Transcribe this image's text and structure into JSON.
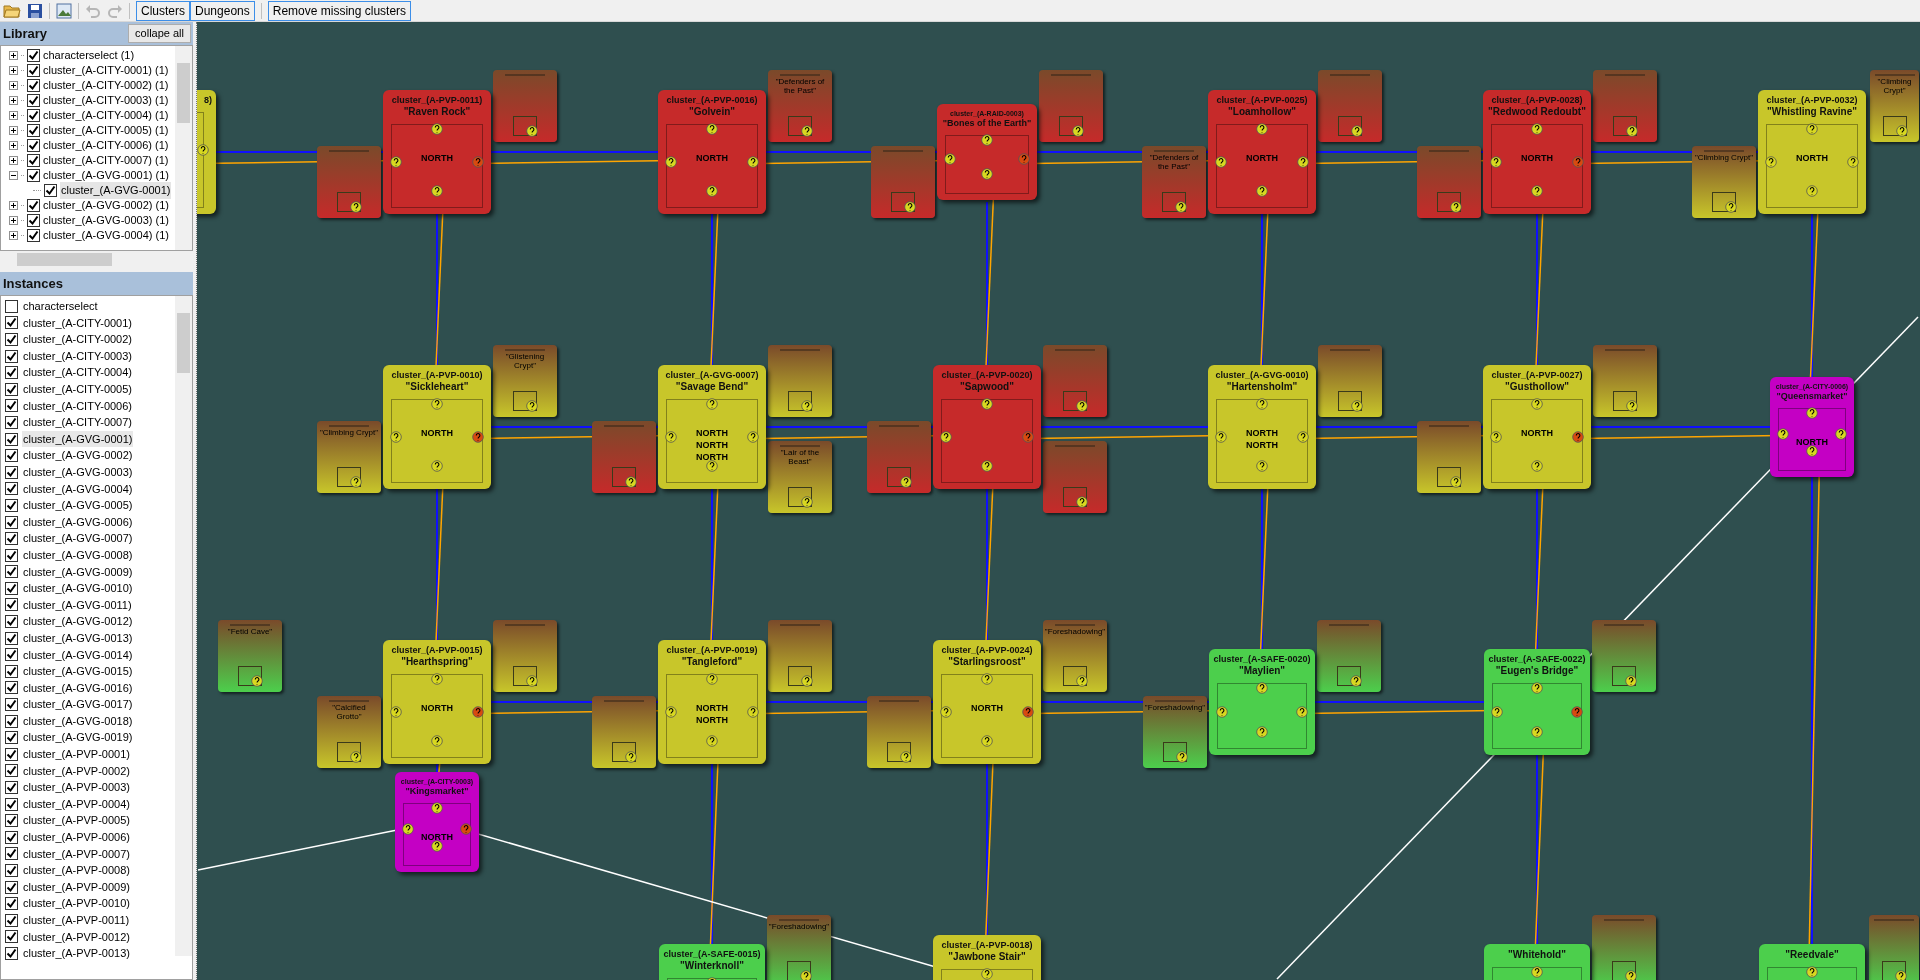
{
  "toolbar": {
    "tools": [
      {
        "kind": "open",
        "disabled": false
      },
      {
        "kind": "save",
        "disabled": false
      },
      {
        "kind": "image",
        "disabled": false
      },
      {
        "kind": "undo",
        "disabled": true
      },
      {
        "kind": "redo",
        "disabled": true
      }
    ],
    "buttons": [
      {
        "label": "Clusters"
      },
      {
        "label": "Dungeons"
      },
      {
        "label": "Remove missing clusters"
      }
    ]
  },
  "library": {
    "title": "Library",
    "collapse_button": "collape all",
    "items": [
      {
        "label": "characterselect (1)",
        "checked": true,
        "expanded": false
      },
      {
        "label": "cluster_(A-CITY-0001) (1)",
        "checked": true,
        "expanded": false
      },
      {
        "label": "cluster_(A-CITY-0002) (1)",
        "checked": true,
        "expanded": false
      },
      {
        "label": "cluster_(A-CITY-0003) (1)",
        "checked": true,
        "expanded": false
      },
      {
        "label": "cluster_(A-CITY-0004) (1)",
        "checked": true,
        "expanded": false
      },
      {
        "label": "cluster_(A-CITY-0005) (1)",
        "checked": true,
        "expanded": false
      },
      {
        "label": "cluster_(A-CITY-0006) (1)",
        "checked": true,
        "expanded": false
      },
      {
        "label": "cluster_(A-CITY-0007) (1)",
        "checked": true,
        "expanded": false
      },
      {
        "label": "cluster_(A-GVG-0001) (1)",
        "checked": true,
        "expanded": true,
        "children": [
          {
            "label": "cluster_(A-GVG-0001)",
            "checked": true,
            "selected": true
          }
        ]
      },
      {
        "label": "cluster_(A-GVG-0002) (1)",
        "checked": true,
        "expanded": false
      },
      {
        "label": "cluster_(A-GVG-0003) (1)",
        "checked": true,
        "expanded": false
      },
      {
        "label": "cluster_(A-GVG-0004) (1)",
        "checked": true,
        "expanded": false
      }
    ]
  },
  "instances": {
    "title": "Instances",
    "items": [
      {
        "label": "characterselect",
        "checked": false,
        "selected": false
      },
      {
        "label": "cluster_(A-CITY-0001)",
        "checked": true,
        "selected": false
      },
      {
        "label": "cluster_(A-CITY-0002)",
        "checked": true,
        "selected": false
      },
      {
        "label": "cluster_(A-CITY-0003)",
        "checked": true,
        "selected": false
      },
      {
        "label": "cluster_(A-CITY-0004)",
        "checked": true,
        "selected": false
      },
      {
        "label": "cluster_(A-CITY-0005)",
        "checked": true,
        "selected": false
      },
      {
        "label": "cluster_(A-CITY-0006)",
        "checked": true,
        "selected": false
      },
      {
        "label": "cluster_(A-CITY-0007)",
        "checked": true,
        "selected": false
      },
      {
        "label": "cluster_(A-GVG-0001)",
        "checked": true,
        "selected": true
      },
      {
        "label": "cluster_(A-GVG-0002)",
        "checked": true,
        "selected": false
      },
      {
        "label": "cluster_(A-GVG-0003)",
        "checked": true,
        "selected": false
      },
      {
        "label": "cluster_(A-GVG-0004)",
        "checked": true,
        "selected": false
      },
      {
        "label": "cluster_(A-GVG-0005)",
        "checked": true,
        "selected": false
      },
      {
        "label": "cluster_(A-GVG-0006)",
        "checked": true,
        "selected": false
      },
      {
        "label": "cluster_(A-GVG-0007)",
        "checked": true,
        "selected": false
      },
      {
        "label": "cluster_(A-GVG-0008)",
        "checked": true,
        "selected": false
      },
      {
        "label": "cluster_(A-GVG-0009)",
        "checked": true,
        "selected": false
      },
      {
        "label": "cluster_(A-GVG-0010)",
        "checked": true,
        "selected": false
      },
      {
        "label": "cluster_(A-GVG-0011)",
        "checked": true,
        "selected": false
      },
      {
        "label": "cluster_(A-GVG-0012)",
        "checked": true,
        "selected": false
      },
      {
        "label": "cluster_(A-GVG-0013)",
        "checked": true,
        "selected": false
      },
      {
        "label": "cluster_(A-GVG-0014)",
        "checked": true,
        "selected": false
      },
      {
        "label": "cluster_(A-GVG-0015)",
        "checked": true,
        "selected": false
      },
      {
        "label": "cluster_(A-GVG-0016)",
        "checked": true,
        "selected": false
      },
      {
        "label": "cluster_(A-GVG-0017)",
        "checked": true,
        "selected": false
      },
      {
        "label": "cluster_(A-GVG-0018)",
        "checked": true,
        "selected": false
      },
      {
        "label": "cluster_(A-GVG-0019)",
        "checked": true,
        "selected": false
      },
      {
        "label": "cluster_(A-PVP-0001)",
        "checked": true,
        "selected": false
      },
      {
        "label": "cluster_(A-PVP-0002)",
        "checked": true,
        "selected": false
      },
      {
        "label": "cluster_(A-PVP-0003)",
        "checked": true,
        "selected": false
      },
      {
        "label": "cluster_(A-PVP-0004)",
        "checked": true,
        "selected": false
      },
      {
        "label": "cluster_(A-PVP-0005)",
        "checked": true,
        "selected": false
      },
      {
        "label": "cluster_(A-PVP-0006)",
        "checked": true,
        "selected": false
      },
      {
        "label": "cluster_(A-PVP-0007)",
        "checked": true,
        "selected": false
      },
      {
        "label": "cluster_(A-PVP-0008)",
        "checked": true,
        "selected": false
      },
      {
        "label": "cluster_(A-PVP-0009)",
        "checked": true,
        "selected": false
      },
      {
        "label": "cluster_(A-PVP-0010)",
        "checked": true,
        "selected": false
      },
      {
        "label": "cluster_(A-PVP-0011)",
        "checked": true,
        "selected": false
      },
      {
        "label": "cluster_(A-PVP-0012)",
        "checked": true,
        "selected": false
      },
      {
        "label": "cluster_(A-PVP-0013)",
        "checked": true,
        "selected": false
      }
    ]
  },
  "map": {
    "rows": [
      [
        {
          "kind": "edge",
          "id": "8)",
          "color": "#c8c62a"
        },
        {
          "kind": "zone",
          "id": "cluster_(A-PVP-0011)",
          "name": "\"Raven Rock\"",
          "color": "#c62a2a",
          "labels": [
            "NORTH"
          ],
          "dungeons": [
            {
              "kind": "red"
            },
            {
              "kind": "red"
            }
          ]
        },
        {
          "kind": "zone",
          "id": "cluster_(A-PVP-0016)",
          "name": "\"Golvein\"",
          "color": "#c62a2a",
          "labels": [
            "NORTH"
          ],
          "dungeons": [
            {
              "kind": "red",
              "title": "\"Defenders of the Past\""
            }
          ]
        },
        {
          "kind": "raid",
          "id": "cluster_(A-RAID-0003)",
          "name": "\"Bones of the Earth\"",
          "color": "#c62a2a",
          "dungeons": [
            {
              "kind": "red"
            },
            {
              "kind": "red"
            }
          ]
        },
        {
          "kind": "zone",
          "id": "cluster_(A-PVP-0025)",
          "name": "\"Loamhollow\"",
          "color": "#c62a2a",
          "labels": [
            "NORTH"
          ],
          "dungeons": [
            {
              "kind": "red"
            },
            {
              "kind": "red",
              "title": "\"Defenders of the Past\""
            }
          ]
        },
        {
          "kind": "zone",
          "id": "cluster_(A-PVP-0028)",
          "name": "\"Redwood Redoubt\"",
          "color": "#c62a2a",
          "labels": [
            "NORTH"
          ],
          "dungeons": [
            {
              "kind": "red"
            },
            {
              "kind": "red"
            }
          ]
        },
        {
          "kind": "zone",
          "id": "cluster_(A-PVP-0032)",
          "name": "\"Whistling Ravine\"",
          "color": "#c8c62a",
          "labels": [
            "NORTH"
          ],
          "dungeons": [
            {
              "kind": "yellow",
              "title": "\"Climbing Crypt\""
            },
            {
              "kind": "yellow",
              "title": "\"Climbing Crypt\""
            }
          ]
        }
      ],
      [
        null,
        {
          "kind": "zone",
          "id": "cluster_(A-PVP-0010)",
          "name": "\"Sickleheart\"",
          "color": "#c8c62a",
          "labels": [
            "NORTH"
          ],
          "dungeons": [
            {
              "kind": "yellow",
              "title": "\"Glistening Crypt\""
            },
            {
              "kind": "yellow",
              "title": "\"Climbing Crypt\""
            }
          ]
        },
        {
          "kind": "zone",
          "id": "cluster_(A-GVG-0007)",
          "name": "\"Savage Bend\"",
          "color": "#c8c62a",
          "labels": [
            "NORTH",
            "NORTH",
            "NORTH"
          ],
          "dungeons": [
            {
              "kind": "yellow"
            },
            {
              "kind": "red"
            },
            {
              "kind": "yellow",
              "title": "\"Lair of the Beast\""
            }
          ]
        },
        {
          "kind": "zone",
          "id": "cluster_(A-PVP-0020)",
          "name": "\"Sapwood\"",
          "color": "#c62a2a",
          "dungeons": [
            {
              "kind": "red"
            },
            {
              "kind": "red"
            },
            {
              "kind": "red"
            }
          ]
        },
        {
          "kind": "zone",
          "id": "cluster_(A-GVG-0010)",
          "name": "\"Hartensholm\"",
          "color": "#c8c62a",
          "labels": [
            "NORTH",
            "NORTH"
          ],
          "dungeons": [
            {
              "kind": "yellow"
            }
          ]
        },
        {
          "kind": "zone",
          "id": "cluster_(A-PVP-0027)",
          "name": "\"Gusthollow\"",
          "color": "#c8c62a",
          "labels": [
            "NORTH"
          ],
          "dungeons": [
            {
              "kind": "yellow"
            },
            {
              "kind": "yellow"
            }
          ]
        },
        {
          "kind": "city",
          "id": "cluster_(A-CITY-0006)",
          "name": "\"Queensmarket\"",
          "color": "#c400c4",
          "labels": [
            "NORTH"
          ]
        }
      ],
      [
        {
          "kind": "none",
          "dungeons": [
            {
              "kind": "green",
              "title": "\"Fetid Cave\""
            }
          ]
        },
        {
          "kind": "zone",
          "id": "cluster_(A-PVP-0015)",
          "name": "\"Hearthspring\"",
          "color": "#c8c62a",
          "labels": [
            "NORTH"
          ],
          "dungeons": [
            {
              "kind": "yellow"
            },
            {
              "kind": "yellow",
              "title": "\"Calcified Grotto\""
            }
          ]
        },
        {
          "kind": "zone",
          "id": "cluster_(A-PVP-0019)",
          "name": "\"Tangleford\"",
          "color": "#c8c62a",
          "labels": [
            "NORTH",
            "NORTH"
          ],
          "dungeons": [
            {
              "kind": "yellow"
            },
            {
              "kind": "yellow"
            }
          ]
        },
        {
          "kind": "zone",
          "id": "cluster_(A-PVP-0024)",
          "name": "\"Starlingsroost\"",
          "color": "#c8c62a",
          "labels": [
            "NORTH"
          ],
          "dungeons": [
            {
              "kind": "yellow",
              "title": "\"Foreshadowing\""
            },
            {
              "kind": "yellow"
            }
          ]
        },
        {
          "kind": "safe",
          "id": "cluster_(A-SAFE-0020)",
          "name": "\"Maylien\"",
          "color": "#4ccf4c",
          "dungeons": [
            {
              "kind": "green"
            },
            {
              "kind": "green",
              "title": "\"Foreshadowing\""
            }
          ]
        },
        {
          "kind": "safe",
          "id": "cluster_(A-SAFE-0022)",
          "name": "\"Eugen's Bridge\"",
          "color": "#4ccf4c",
          "dungeons": [
            {
              "kind": "green"
            }
          ]
        },
        null
      ],
      [
        null,
        {
          "kind": "city",
          "id": "cluster_(A-CITY-0003)",
          "name": "\"Kingsmarket\"",
          "color": "#c400c4",
          "labels": [
            "NORTH"
          ]
        },
        null,
        null,
        null,
        null,
        null
      ],
      [
        null,
        null,
        {
          "kind": "safe",
          "id": "cluster_(A-SAFE-0015)",
          "name": "\"Winterknoll\"",
          "color": "#4ccf4c",
          "dungeons": [
            {
              "kind": "green",
              "title": "\"Foreshadowing\""
            }
          ]
        },
        {
          "kind": "zone",
          "id": "cluster_(A-PVP-0018)",
          "name": "\"Jawbone Stair\"",
          "color": "#c8c62a"
        },
        null,
        {
          "kind": "safe",
          "name": "\"Whitehold\"",
          "color": "#4ccf4c",
          "dungeons": [
            {
              "kind": "green"
            }
          ]
        },
        {
          "kind": "safe",
          "name": "\"Reedvale\"",
          "color": "#4ccf4c",
          "dungeons": [
            {
              "kind": "green"
            }
          ]
        }
      ]
    ]
  }
}
